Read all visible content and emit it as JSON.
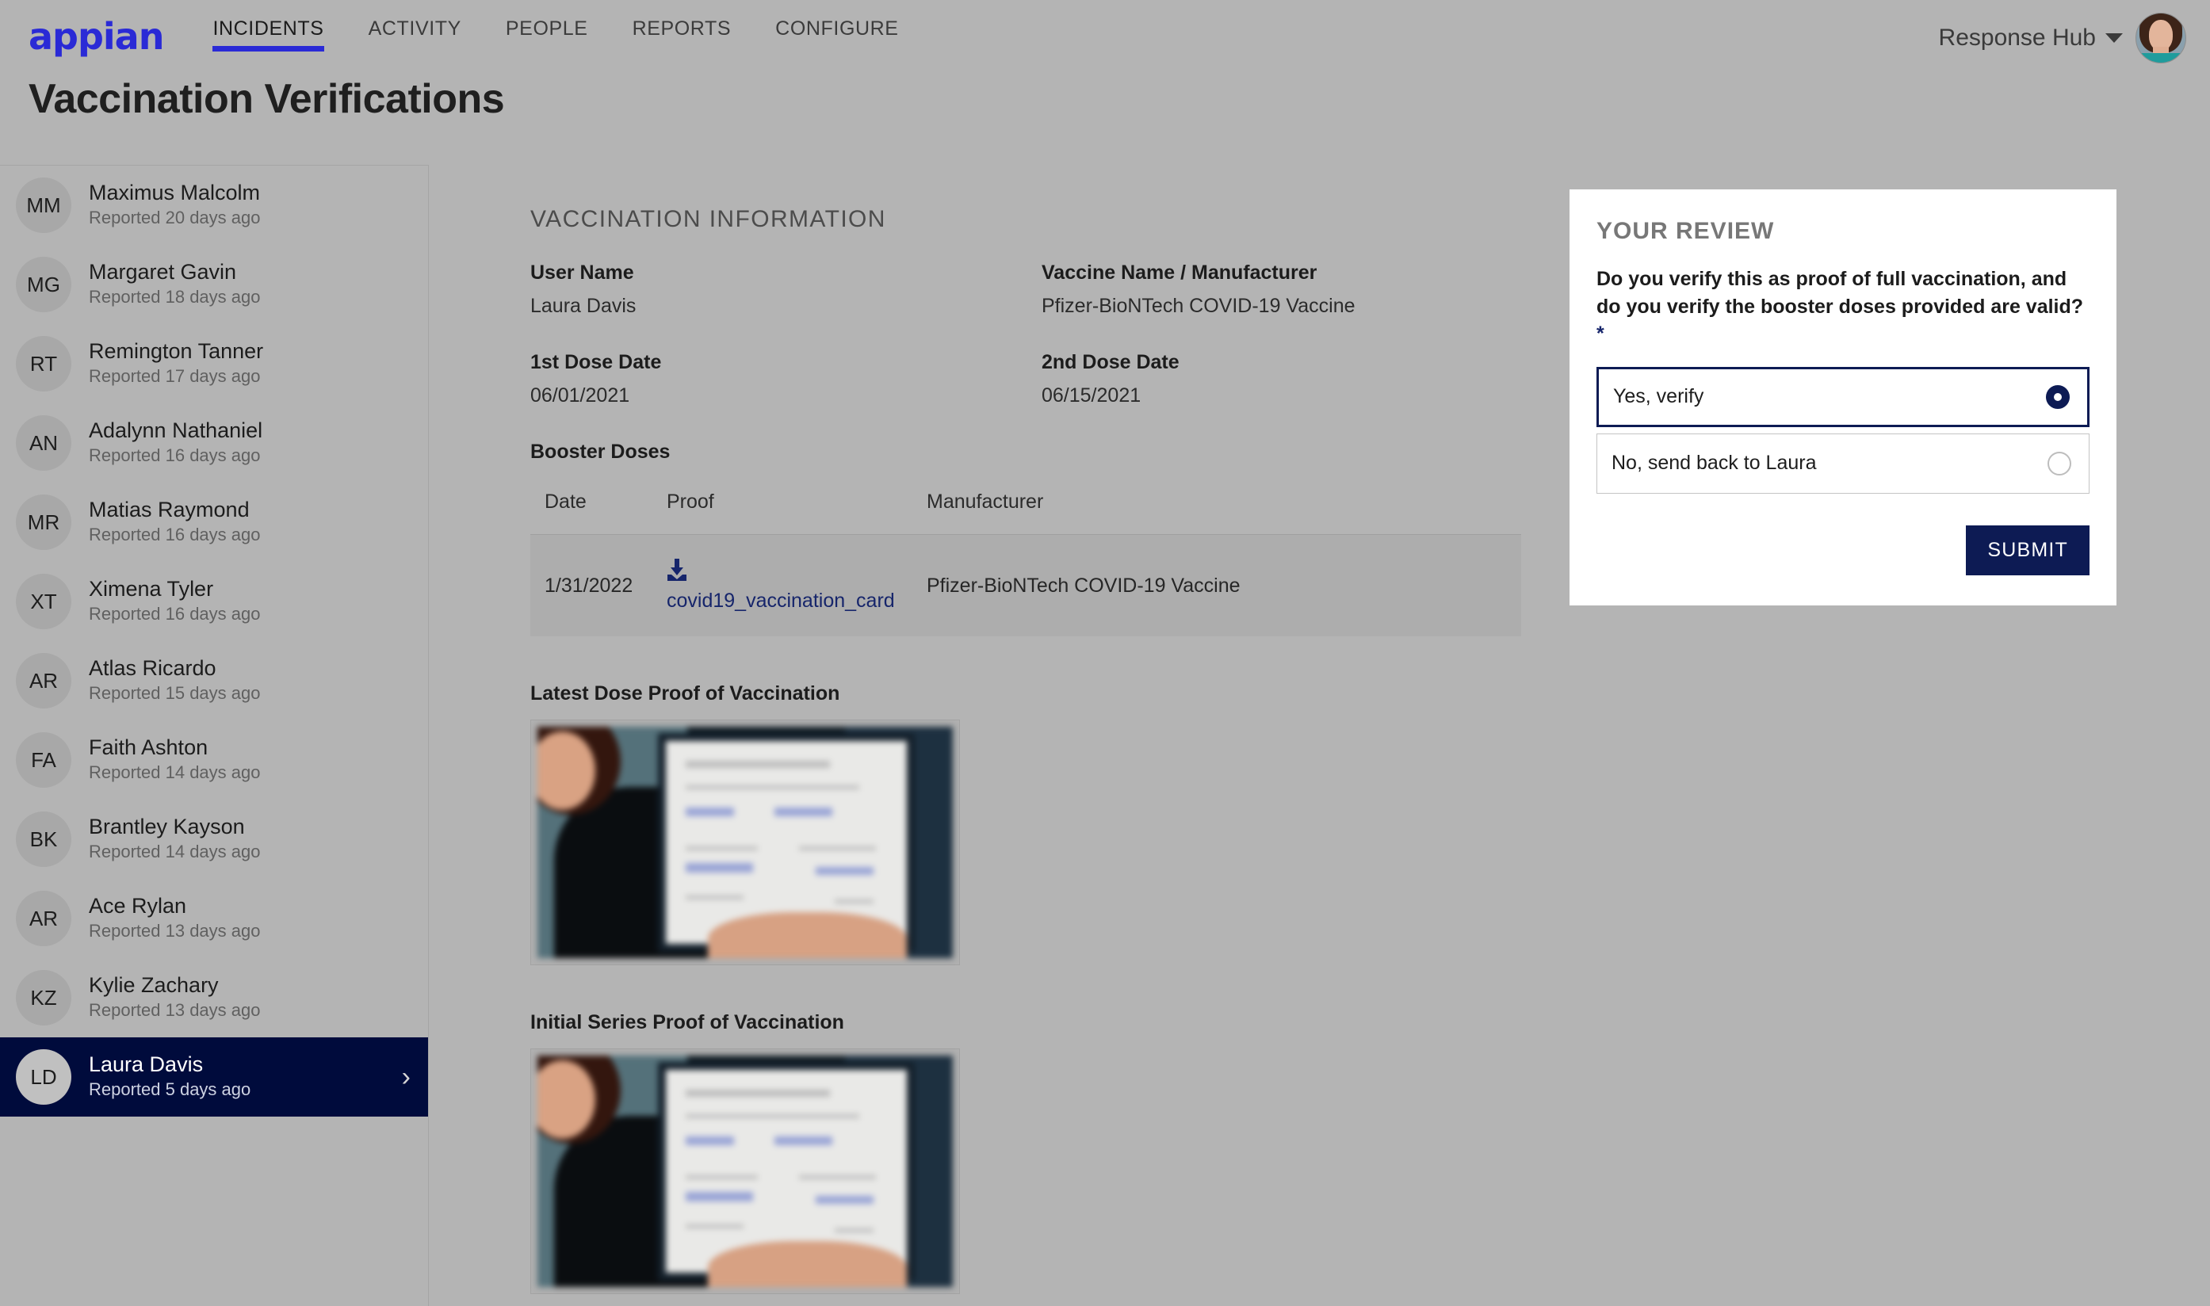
{
  "brand": {
    "logo_text": "appian",
    "accent": "#2a2ad6",
    "navy": "#0d1b54"
  },
  "nav": {
    "items": [
      {
        "label": "INCIDENTS",
        "active": true
      },
      {
        "label": "ACTIVITY",
        "active": false
      },
      {
        "label": "PEOPLE",
        "active": false
      },
      {
        "label": "REPORTS",
        "active": false
      },
      {
        "label": "CONFIGURE",
        "active": false
      }
    ]
  },
  "user": {
    "name": "Response Hub"
  },
  "page": {
    "title": "Vaccination Verifications"
  },
  "sidebar": {
    "items": [
      {
        "initials": "MM",
        "name": "Maximus Malcolm",
        "reported": "Reported 20 days ago",
        "selected": false
      },
      {
        "initials": "MG",
        "name": "Margaret Gavin",
        "reported": "Reported 18 days ago",
        "selected": false
      },
      {
        "initials": "RT",
        "name": "Remington Tanner",
        "reported": "Reported 17 days ago",
        "selected": false
      },
      {
        "initials": "AN",
        "name": "Adalynn Nathaniel",
        "reported": "Reported 16 days ago",
        "selected": false
      },
      {
        "initials": "MR",
        "name": "Matias Raymond",
        "reported": "Reported 16 days ago",
        "selected": false
      },
      {
        "initials": "XT",
        "name": "Ximena Tyler",
        "reported": "Reported 16 days ago",
        "selected": false
      },
      {
        "initials": "AR",
        "name": "Atlas Ricardo",
        "reported": "Reported 15 days ago",
        "selected": false
      },
      {
        "initials": "FA",
        "name": "Faith Ashton",
        "reported": "Reported 14 days ago",
        "selected": false
      },
      {
        "initials": "BK",
        "name": "Brantley Kayson",
        "reported": "Reported 14 days ago",
        "selected": false
      },
      {
        "initials": "AR",
        "name": "Ace Rylan",
        "reported": "Reported 13 days ago",
        "selected": false
      },
      {
        "initials": "KZ",
        "name": "Kylie Zachary",
        "reported": "Reported 13 days ago",
        "selected": false
      },
      {
        "initials": "LD",
        "name": "Laura Davis",
        "reported": "Reported 5 days ago",
        "selected": true
      }
    ]
  },
  "vaccination": {
    "section_title": "VACCINATION INFORMATION",
    "user_name_label": "User Name",
    "user_name_value": "Laura Davis",
    "vaccine_label": "Vaccine Name / Manufacturer",
    "vaccine_value": "Pfizer-BioNTech COVID-19 Vaccine",
    "dose1_label": "1st Dose Date",
    "dose1_value": "06/01/2021",
    "dose2_label": "2nd Dose Date",
    "dose2_value": "06/15/2021",
    "booster_label": "Booster Doses",
    "booster_table": {
      "columns": [
        "Date",
        "Proof",
        "Manufacturer"
      ],
      "rows": [
        {
          "date": "1/31/2022",
          "proof": "covid19_vaccination_card",
          "manufacturer": "Pfizer-BioNTech COVID-19 Vaccine"
        }
      ]
    },
    "latest_proof_label": "Latest Dose Proof of Vaccination",
    "initial_proof_label": "Initial Series Proof of Vaccination"
  },
  "review": {
    "heading": "YOUR REVIEW",
    "question": "Do you verify this as proof of full vaccination, and do you verify the booster doses provided are valid?",
    "required_marker": "*",
    "options": [
      {
        "label": "Yes, verify",
        "checked": true
      },
      {
        "label": "No, send back to Laura",
        "checked": false
      }
    ],
    "submit_label": "SUBMIT"
  }
}
